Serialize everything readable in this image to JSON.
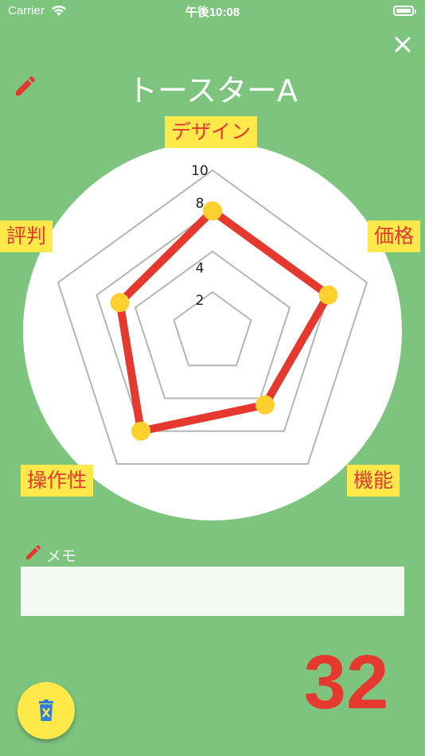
{
  "status_bar": {
    "carrier": "Carrier",
    "time": "午後10:08"
  },
  "header": {
    "title": "トースターA"
  },
  "colors": {
    "background": "#7dc57f",
    "accent": "#e5392f",
    "label_bg": "#ffe84a",
    "marker": "#fcd12f",
    "grid": "#b5b5b5"
  },
  "chart_data": {
    "type": "radar",
    "axes": [
      "デザイン",
      "価格",
      "機能",
      "操作性",
      "評判"
    ],
    "values": [
      7.5,
      7.5,
      5.5,
      7.5,
      6
    ],
    "max": 10,
    "tick_labels": [
      "2",
      "4",
      "8",
      "10"
    ]
  },
  "memo": {
    "label": "メモ",
    "value": "",
    "placeholder": ""
  },
  "score": {
    "total": "32"
  }
}
